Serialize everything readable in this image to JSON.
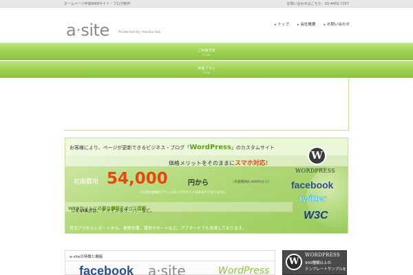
{
  "topbar": {
    "tagline": "ホームページ作成WEBサイト・ブログ制作",
    "phone": "お問い合わせはこちら：03-4455-7257"
  },
  "logo": {
    "mark_a": "a",
    "mark_dot": "·",
    "mark_rest": "site",
    "powered": "Powered by media-lab"
  },
  "headnav": [
    "トップ",
    "会社概要",
    "お問い合わせ"
  ],
  "nav": [
    {
      "jp": "ご利用方法",
      "en": "PLAN"
    },
    {
      "jp": "料金プラン",
      "en": "FLOW"
    }
  ],
  "banner": {
    "line1_pre": "お客様により、ページが更新できるビジネス・ブログ「",
    "line1_wp": "WordPress",
    "line1_post": "」のカスタムサイト",
    "line2_pre": "価格メリットをそのままに",
    "line2_sp": "スマホ対応",
    "line2_post": "！",
    "fee_label": "初期費用",
    "price": "54,000",
    "from": "円から",
    "monthly": "（月額費用5,400円から）",
    "note": "※上記の金額のプランにはスマホサイトは含まれておりません",
    "line3_pre": "「a-site」は、ドメイン＆サーバーなど、",
    "line3_hl": "WEBサイトに必要な機能をすべて搭載",
    "line3_post": "しています。",
    "line4": "月次アクセスレポートから、更新作業、運用サポートなど、アフターケアも充実しております。",
    "logos": {
      "wp_glyph": "W",
      "wp": "WORDPRESS",
      "fb": "facebook",
      "tw": "twitter",
      "w3c": "W3C"
    }
  },
  "section": {
    "title": "a-siteの特徴と機能",
    "preview_fb": "facebook",
    "preview_logo": "a·site",
    "preview_wp": "WordPress"
  },
  "sidead": {
    "glyph": "W",
    "brand": "WORDPRESS",
    "line1": "900種類以上の",
    "line2": "テンプレートサンプルを見る"
  },
  "colors": {
    "brand_green": "#8cc63f",
    "accent_orange": "#e8470c",
    "facebook_blue": "#2d4f8f",
    "twitter_blue": "#2aa9e0"
  }
}
